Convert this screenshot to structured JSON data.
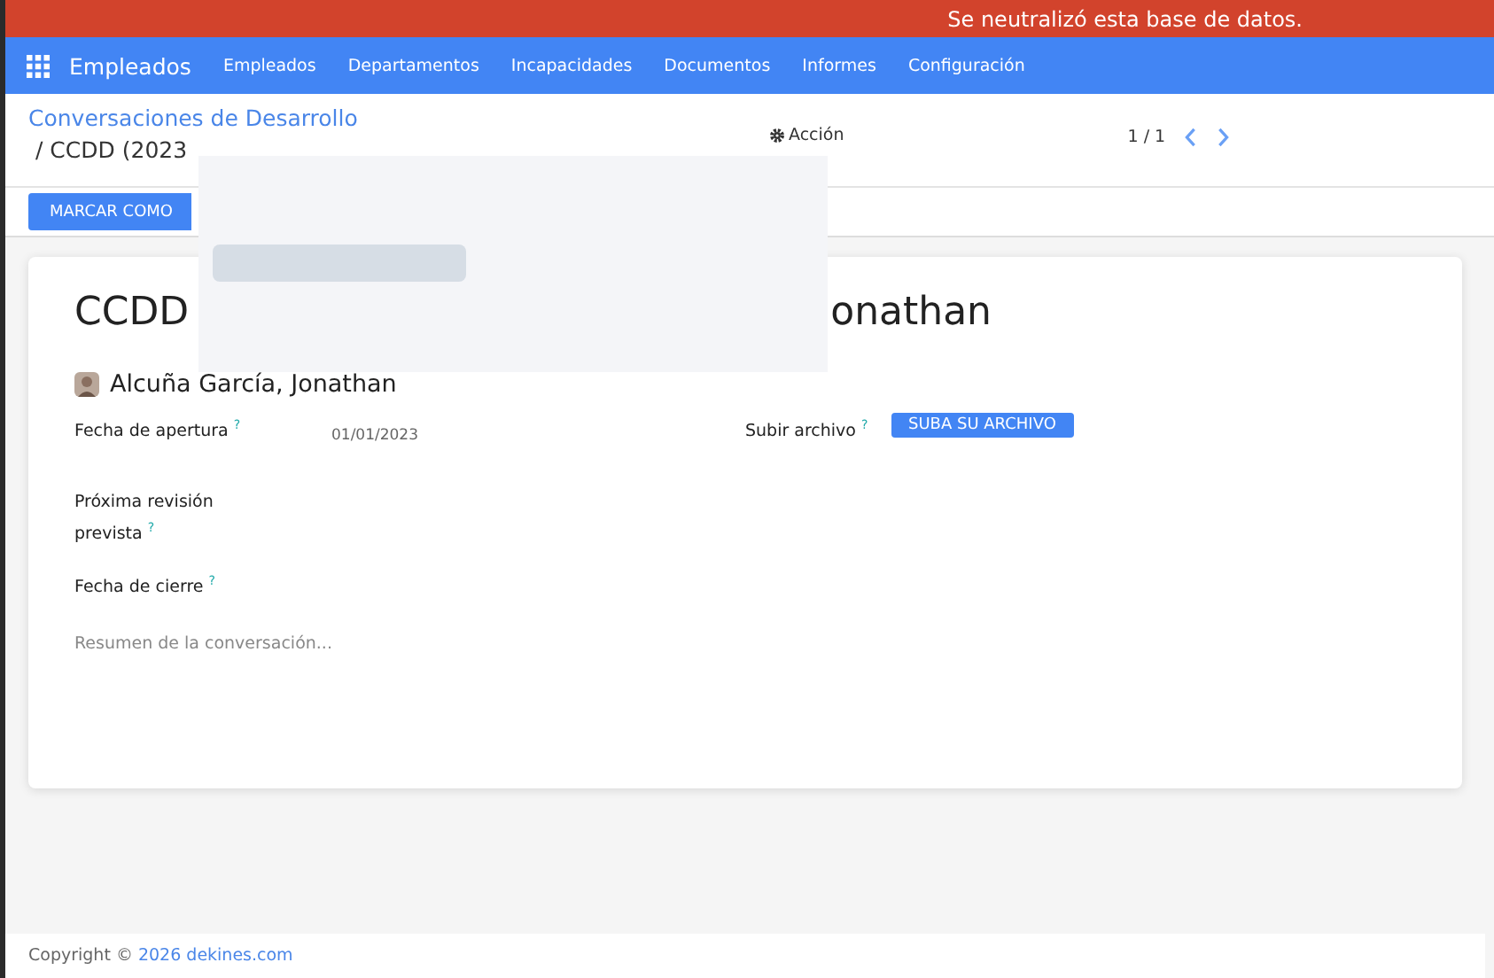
{
  "banner": {
    "text": "Se neutralizó esta base de datos."
  },
  "navbar": {
    "app": "Empleados",
    "menu": [
      "Empleados",
      "Departamentos",
      "Incapacidades",
      "Documentos",
      "Informes",
      "Configuración"
    ]
  },
  "control_panel": {
    "breadcrumb_link": "Conversaciones de Desarrollo",
    "breadcrumb_current": "/ CCDD (2023",
    "action": "Acción",
    "pager": "1 / 1",
    "buttons": [
      "MARCAR COMO"
    ]
  },
  "overlay": {
    "kind": "loading"
  },
  "form": {
    "title_start": "CCDD",
    "title_end": "onathan",
    "employee": "Alcuña García, Jonathan",
    "left_fields": [
      {
        "label": "Fecha de apertura",
        "help": "?",
        "value": "01/01/2023"
      },
      {
        "label": "Próxima revisión prevista",
        "help": "?"
      },
      {
        "label": "Fecha de cierre",
        "help": "?"
      }
    ],
    "right_fields": [
      {
        "label": "Subir archivo",
        "help": "?",
        "button": "SUBA SU ARCHIVO"
      }
    ],
    "summary_placeholder": "Resumen de la conversación..."
  },
  "footer": {
    "text": "Copyright ©",
    "link": "2026 dekines.com"
  }
}
